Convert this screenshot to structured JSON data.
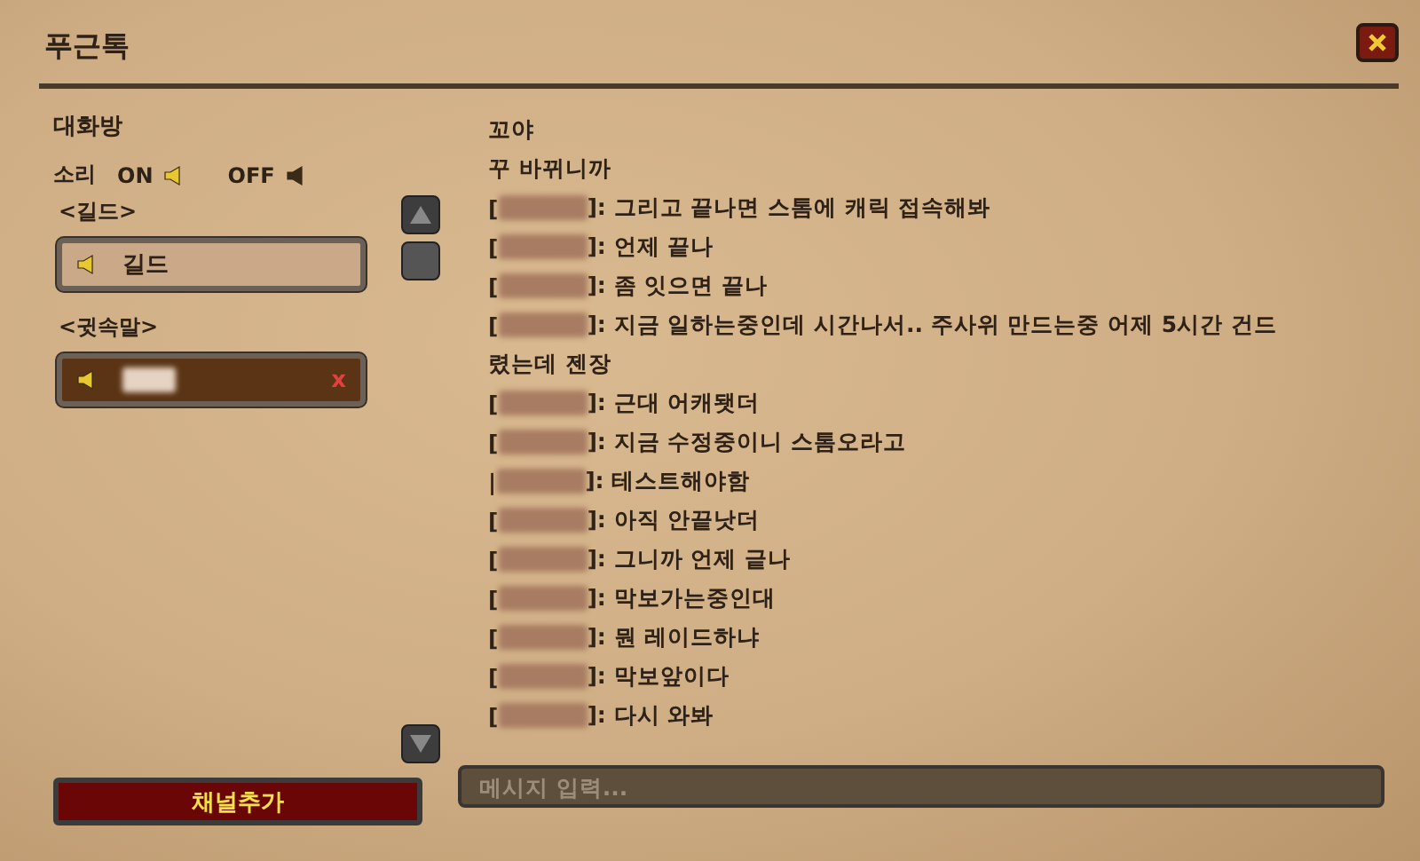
{
  "window": {
    "title": "푸근톡"
  },
  "sidebar": {
    "heading": "대화방",
    "sound_label": "소리",
    "sound_on": "ON",
    "sound_off": "OFF",
    "sections": [
      {
        "label": "<길드>",
        "channels": [
          {
            "name": "길드",
            "selected": false
          }
        ]
      },
      {
        "label": "<귓속말>",
        "channels": [
          {
            "selected": true,
            "close_label": "x"
          }
        ]
      }
    ],
    "add_button": "채널추가"
  },
  "messages": [
    {
      "kind": "continuation",
      "text": "꼬야"
    },
    {
      "kind": "continuation",
      "text": "꾸 바뀌니까"
    },
    {
      "kind": "message",
      "open": "[",
      "text": "]: 그리고 끝나면 스톰에 캐릭 접속해봐"
    },
    {
      "kind": "message",
      "open": "[",
      "text": "]: 언제 끝나"
    },
    {
      "kind": "message",
      "open": "[",
      "text": "]: 좀 잇으면 끝나"
    },
    {
      "kind": "message",
      "open": "[",
      "text": "]: 지금 일하는중인데 시간나서.. 주사위 만드는중 어제 5시간 건드"
    },
    {
      "kind": "continuation",
      "text": "렸는데 젠장"
    },
    {
      "kind": "message",
      "open": "[",
      "text": "]: 근대 어캐됏더"
    },
    {
      "kind": "message",
      "open": "[",
      "text": "]: 지금 수정중이니 스톰오라고"
    },
    {
      "kind": "message",
      "open": "|",
      "text": "]: 테스트해야함"
    },
    {
      "kind": "message",
      "open": "[",
      "text": "]: 아직 안끝낫더"
    },
    {
      "kind": "message",
      "open": "[",
      "text": "]: 그니까 언제 긑나"
    },
    {
      "kind": "message",
      "open": "[",
      "text": "]: 막보가는중인대"
    },
    {
      "kind": "message",
      "open": "[",
      "text": "]: 뭔 레이드하냐"
    },
    {
      "kind": "message",
      "open": "[",
      "text": "]: 막보앞이다"
    },
    {
      "kind": "message",
      "open": "[",
      "text": "]: 다시 와봐"
    }
  ],
  "input": {
    "placeholder": "메시지 입력..."
  }
}
